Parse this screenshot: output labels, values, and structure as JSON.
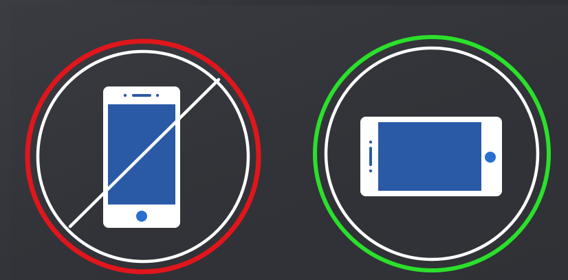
{
  "colors": {
    "background": "#2e3036",
    "prohibited_ring": "#e0161c",
    "allowed_ring": "#2be02b",
    "inner_ring": "#ffffff",
    "phone_body": "#ffffff",
    "phone_screen": "#2a5aa6",
    "phone_button": "#2a6fd0"
  },
  "icons": {
    "portrait": {
      "name": "portrait-phone-prohibited-icon",
      "status": "prohibited",
      "orientation": "portrait"
    },
    "landscape": {
      "name": "landscape-phone-allowed-icon",
      "status": "allowed",
      "orientation": "landscape"
    }
  }
}
